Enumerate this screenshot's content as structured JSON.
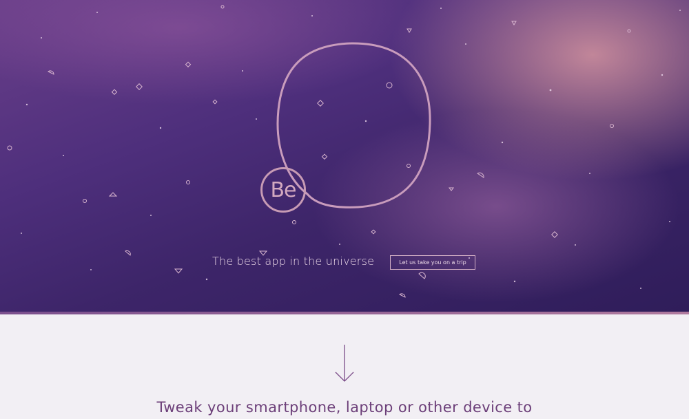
{
  "hero": {
    "logo_text": "Be",
    "tagline": "The best app in the universe",
    "cta_label": "Let us take you on a trip"
  },
  "icons": {
    "scroll_arrow": "arrow-down-icon"
  },
  "section": {
    "heading": "Tweak your smartphone, laptop or other device to"
  },
  "colors": {
    "hero_dark": "#2f1d5a",
    "hero_pink": "#d796a0",
    "accent": "#c79bb4",
    "heading": "#6c3f79",
    "background": "#f2eff4"
  }
}
